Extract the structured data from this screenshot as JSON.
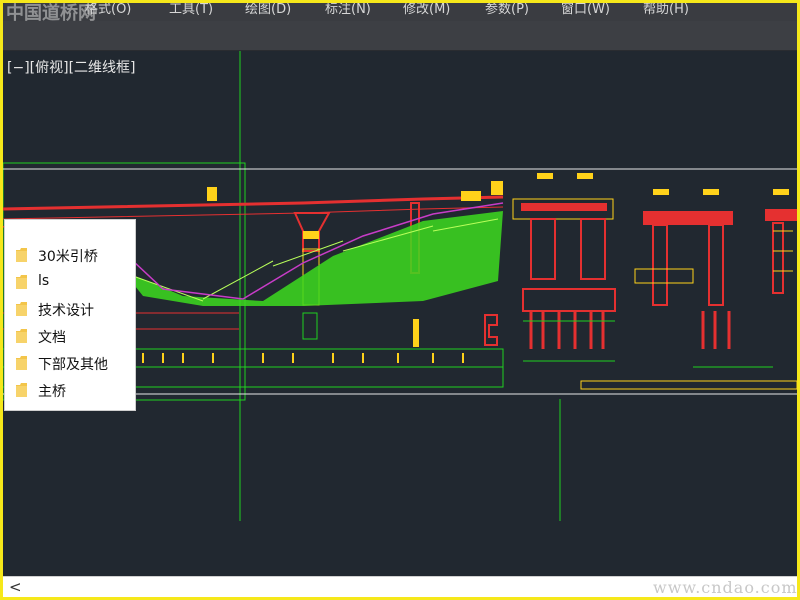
{
  "menubar": {
    "items": [
      "格式(O)",
      "工具(T)",
      "绘图(D)",
      "标注(N)",
      "修改(M)",
      "参数(P)",
      "窗口(W)",
      "帮助(H)"
    ]
  },
  "viewport": {
    "label": "[−][俯视][二维线框]"
  },
  "folders": [
    "30米引桥",
    "ls",
    "技术设计",
    "文档",
    "下部及其他",
    "主桥"
  ],
  "statusbar": {
    "scroll_left": "<"
  },
  "watermarks": {
    "cn": "中国道桥网",
    "url": "www.cndao.com"
  },
  "colors": {
    "canvas": "#212830",
    "frame": "#f6e81a",
    "folder": "#f3c54a"
  }
}
